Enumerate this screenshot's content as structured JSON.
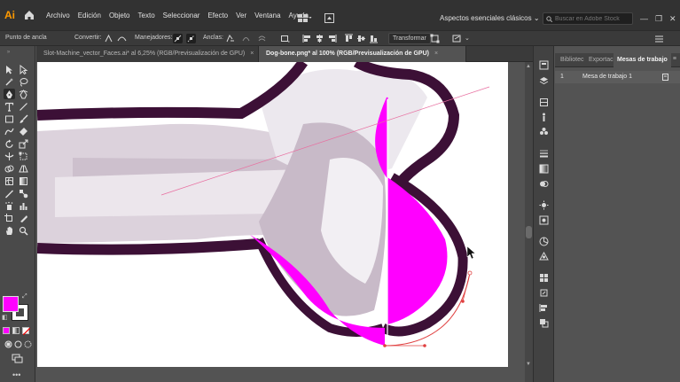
{
  "app": {
    "logo": "Ai"
  },
  "menu": [
    "Archivo",
    "Edición",
    "Objeto",
    "Texto",
    "Seleccionar",
    "Efecto",
    "Ver",
    "Ventana",
    "Ayuda"
  ],
  "workspace": {
    "label": "Aspectos esenciales clásicos"
  },
  "search": {
    "placeholder": "Buscar en Adobe Stock"
  },
  "control_bar": {
    "anchor_label": "Punto de ancla",
    "convert_label": "Convertir:",
    "handles_label": "Manejadores:",
    "anchors_label": "Anclas:",
    "transform_label": "Transformar"
  },
  "tabs": [
    {
      "label": "Slot-Machine_vector_Faces.ai* al 6,25% (RGB/Previsualización de GPU)",
      "close": "×"
    },
    {
      "label": "Dog-bone.png* al 100% (RGB/Previsualización de GPU)",
      "close": "×"
    }
  ],
  "panel": {
    "tabs": [
      "Bibliotec",
      "Exportac",
      "Mesas de trabajo"
    ],
    "menu_icon": "≡",
    "rows": [
      {
        "num": "1",
        "name": "Mesa de trabajo 1"
      }
    ]
  },
  "colors": {
    "fill": "#ff00ff",
    "stroke": "#ffffff",
    "accent": "#ff9a00"
  },
  "icons": {
    "tools": [
      "selection-icon",
      "direct-selection-icon",
      "magic-wand-icon",
      "lasso-icon",
      "pen-icon",
      "curvature-icon",
      "type-icon",
      "line-icon",
      "rectangle-icon",
      "paintbrush-icon",
      "shaper-icon",
      "eraser-icon",
      "rotate-icon",
      "scale-icon",
      "width-icon",
      "warp-icon",
      "free-transform-icon",
      "shape-builder-icon",
      "perspective-icon",
      "mesh-icon",
      "gradient-icon",
      "eyedropper-icon",
      "blend-icon",
      "symbol-sprayer-icon",
      "column-graph-icon",
      "artboard-icon",
      "slice-icon",
      "hand-icon",
      "zoom-icon"
    ]
  }
}
